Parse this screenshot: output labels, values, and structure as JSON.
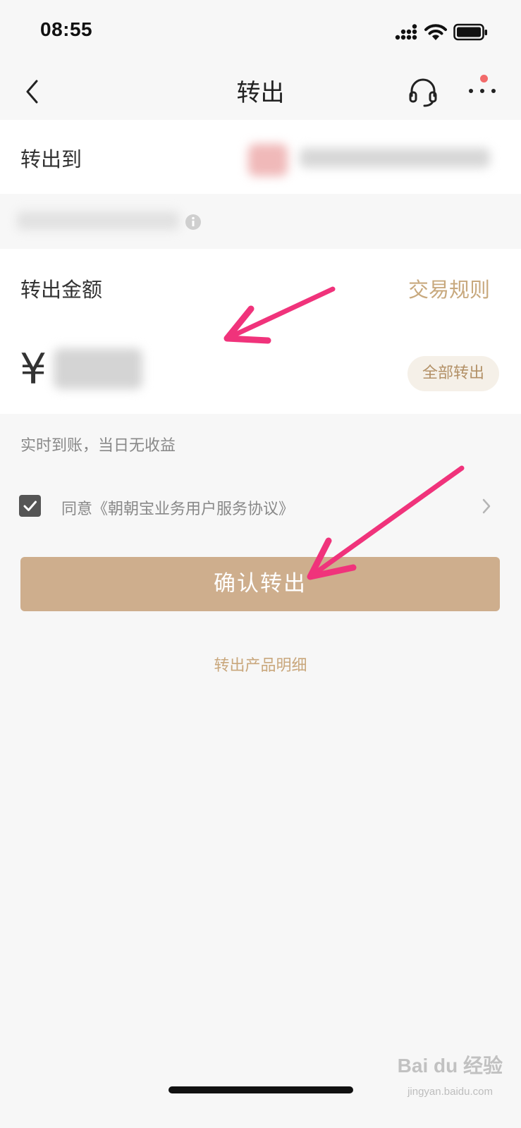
{
  "status_bar": {
    "time": "08:55"
  },
  "nav": {
    "title": "转出",
    "notification_dot_color": "#f26b6b"
  },
  "transfer_to": {
    "label": "转出到"
  },
  "amount_section": {
    "label": "转出金额",
    "rules_link": "交易规则",
    "currency_symbol": "¥",
    "all_button": "全部转出"
  },
  "note": "实时到账，当日无收益",
  "agreement": {
    "text": "同意《朝朝宝业务用户服务协议》",
    "checked": true
  },
  "confirm_button": "确认转出",
  "detail_link": "转出产品明细",
  "watermark": {
    "main": "Bai du 经验",
    "sub": "jingyan.baidu.com"
  },
  "colors": {
    "accent_gold": "#ceae8d",
    "link_gold": "#c8a97e",
    "annotation_arrow": "#f0337b"
  }
}
